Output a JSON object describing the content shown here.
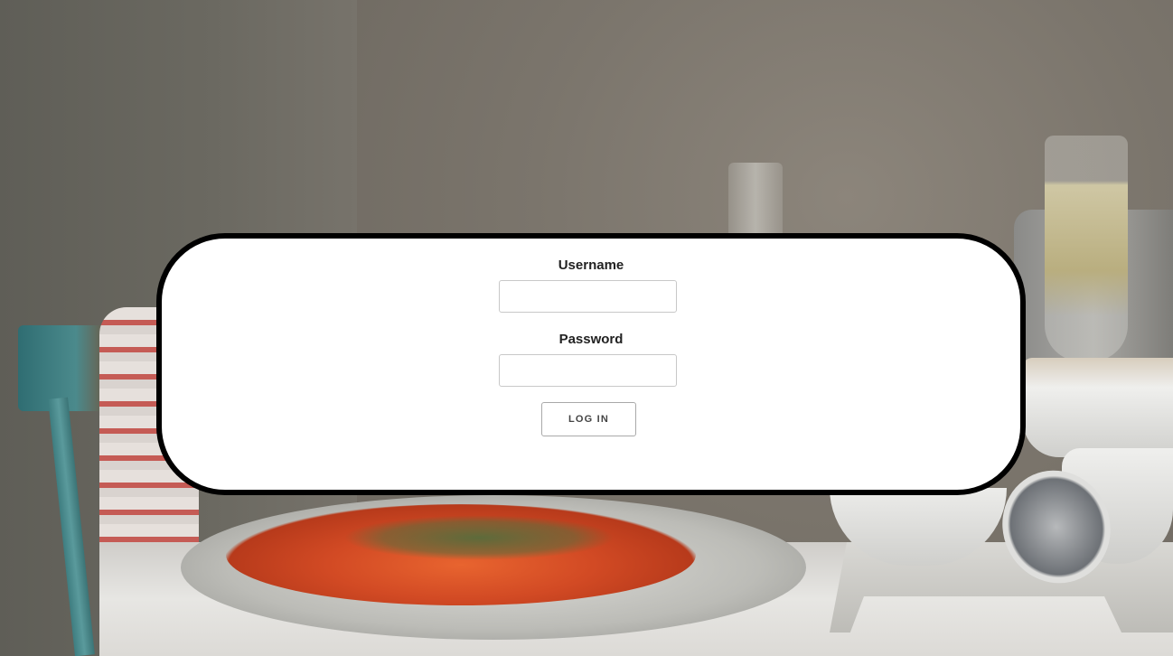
{
  "background": {
    "description_icon": "food-photo-background"
  },
  "login_form": {
    "username_label": "Username",
    "username_value": "",
    "password_label": "Password",
    "password_value": "",
    "login_button_label": "LOG IN"
  },
  "colors": {
    "panel_background": "#ffffff",
    "panel_border": "#000000",
    "label_text": "#222222",
    "button_text": "#444444"
  }
}
